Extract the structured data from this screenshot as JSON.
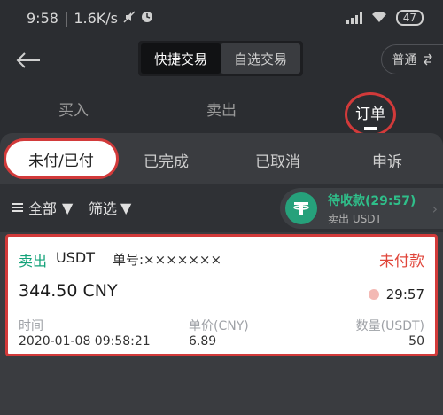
{
  "status_bar": {
    "time": "9:58",
    "speed": "1.6K/s",
    "battery": "47"
  },
  "header": {
    "mode_quick": "快捷交易",
    "mode_self": "自选交易",
    "normal_label": "普通"
  },
  "tabs": {
    "buy": "买入",
    "sell": "卖出",
    "orders": "订单"
  },
  "subtabs": {
    "unpaid_paid": "未付/已付",
    "completed": "已完成",
    "cancelled": "已取消",
    "appeal": "申诉"
  },
  "filter": {
    "all": "全部",
    "screen": "筛选"
  },
  "pending": {
    "title": "待收款(29:57)",
    "subtitle": "卖出 USDT"
  },
  "order": {
    "type": "卖出",
    "coin": "USDT",
    "order_no": "单号:×××××××",
    "status": "未付款",
    "amount": "344.50 CNY",
    "timer": "29:57",
    "time_label": "时间",
    "time_value": "2020-01-08 09:58:21",
    "price_label": "单价(CNY)",
    "price_value": "6.89",
    "qty_label": "数量(USDT)",
    "qty_value": "50"
  }
}
